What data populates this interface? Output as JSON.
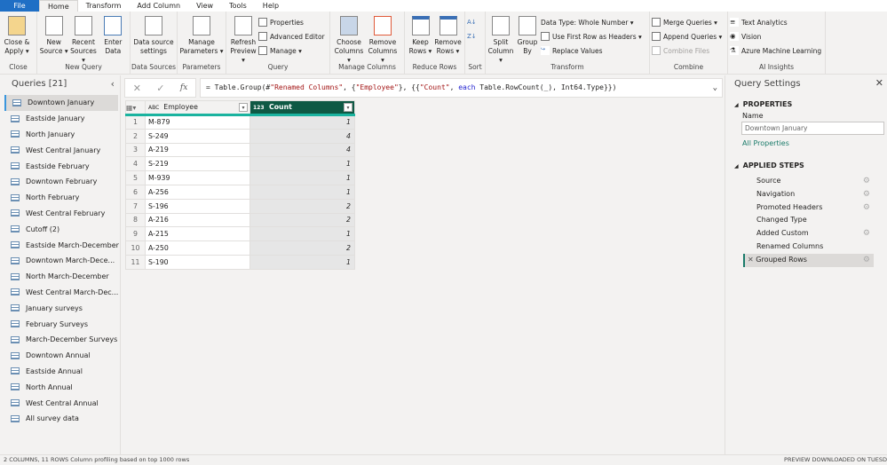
{
  "tabs": [
    "File",
    "Home",
    "Transform",
    "Add Column",
    "View",
    "Tools",
    "Help"
  ],
  "ribbon": {
    "close": {
      "label": "Close",
      "close_apply": "Close & Apply ▾"
    },
    "new_query": {
      "label": "New Query",
      "new_source": "New Source ▾",
      "recent_sources": "Recent Sources ▾",
      "enter_data": "Enter Data"
    },
    "data_sources": {
      "label": "Data Sources",
      "settings": "Data source settings"
    },
    "parameters": {
      "label": "Parameters",
      "manage": "Manage Parameters ▾"
    },
    "query": {
      "label": "Query",
      "refresh": "Refresh Preview ▾",
      "properties": "Properties",
      "advanced_editor": "Advanced Editor",
      "manage": "Manage ▾"
    },
    "manage_columns": {
      "label": "Manage Columns",
      "choose": "Choose Columns ▾",
      "remove": "Remove Columns ▾"
    },
    "reduce_rows": {
      "label": "Reduce Rows",
      "keep": "Keep Rows ▾",
      "remove": "Remove Rows ▾"
    },
    "sort": {
      "label": "Sort"
    },
    "transform": {
      "label": "Transform",
      "split": "Split Column ▾",
      "group_by": "Group By",
      "data_type": "Data Type: Whole Number ▾",
      "first_row": "Use First Row as Headers ▾",
      "replace": "Replace Values"
    },
    "combine": {
      "label": "Combine",
      "merge": "Merge Queries ▾",
      "append": "Append Queries ▾",
      "combine_files": "Combine Files"
    },
    "ai": {
      "label": "AI Insights",
      "text": "Text Analytics",
      "vision": "Vision",
      "azure": "Azure Machine Learning"
    }
  },
  "queries": {
    "title": "Queries [21]",
    "items": [
      "Downtown January",
      "Eastside January",
      "North January",
      "West Central January",
      "Eastside February",
      "Downtown February",
      "North February",
      "West Central February",
      "Cutoff (2)",
      "Eastside March-December",
      "Downtown March-Dece...",
      "North March-December",
      "West Central March-Dec...",
      "January surveys",
      "February Surveys",
      "March-December Surveys",
      "Downtown Annual",
      "Eastside Annual",
      "North Annual",
      "West Central Annual",
      "All survey data"
    ]
  },
  "formula": {
    "p1": "= Table.Group(#",
    "s1": "\"Renamed Columns\"",
    "p2": ", {",
    "s2": "\"Employee\"",
    "p3": "}, {{",
    "s3": "\"Count\"",
    "p4": ", ",
    "kw": "each",
    "p5": " Table.RowCount(_), Int64.Type}})"
  },
  "table": {
    "columns": [
      {
        "type": "ABC",
        "name": "Employee"
      },
      {
        "type": "123",
        "name": "Count"
      }
    ],
    "rows": [
      [
        "M-879",
        "1"
      ],
      [
        "S-249",
        "4"
      ],
      [
        "A-219",
        "4"
      ],
      [
        "S-219",
        "1"
      ],
      [
        "M-939",
        "1"
      ],
      [
        "A-256",
        "1"
      ],
      [
        "S-196",
        "2"
      ],
      [
        "A-216",
        "2"
      ],
      [
        "A-215",
        "1"
      ],
      [
        "A-250",
        "2"
      ],
      [
        "S-190",
        "1"
      ]
    ]
  },
  "settings": {
    "title": "Query Settings",
    "properties": "PROPERTIES",
    "name_label": "Name",
    "name_value": "Downtown January",
    "all_properties": "All Properties",
    "applied_steps": "APPLIED STEPS",
    "steps": [
      {
        "name": "Source",
        "gear": true
      },
      {
        "name": "Navigation",
        "gear": true
      },
      {
        "name": "Promoted Headers",
        "gear": true
      },
      {
        "name": "Changed Type",
        "gear": false
      },
      {
        "name": "Added Custom",
        "gear": true
      },
      {
        "name": "Renamed Columns",
        "gear": false
      },
      {
        "name": "Grouped Rows",
        "gear": true
      }
    ]
  },
  "status": {
    "left": "2 COLUMNS, 11 ROWS     Column profiling based on top 1000 rows",
    "right": "PREVIEW DOWNLOADED ON TUESD"
  },
  "colors": {
    "accent": "#0e5944",
    "file_tab": "#1f6fc5",
    "link": "#1a7b6a"
  }
}
